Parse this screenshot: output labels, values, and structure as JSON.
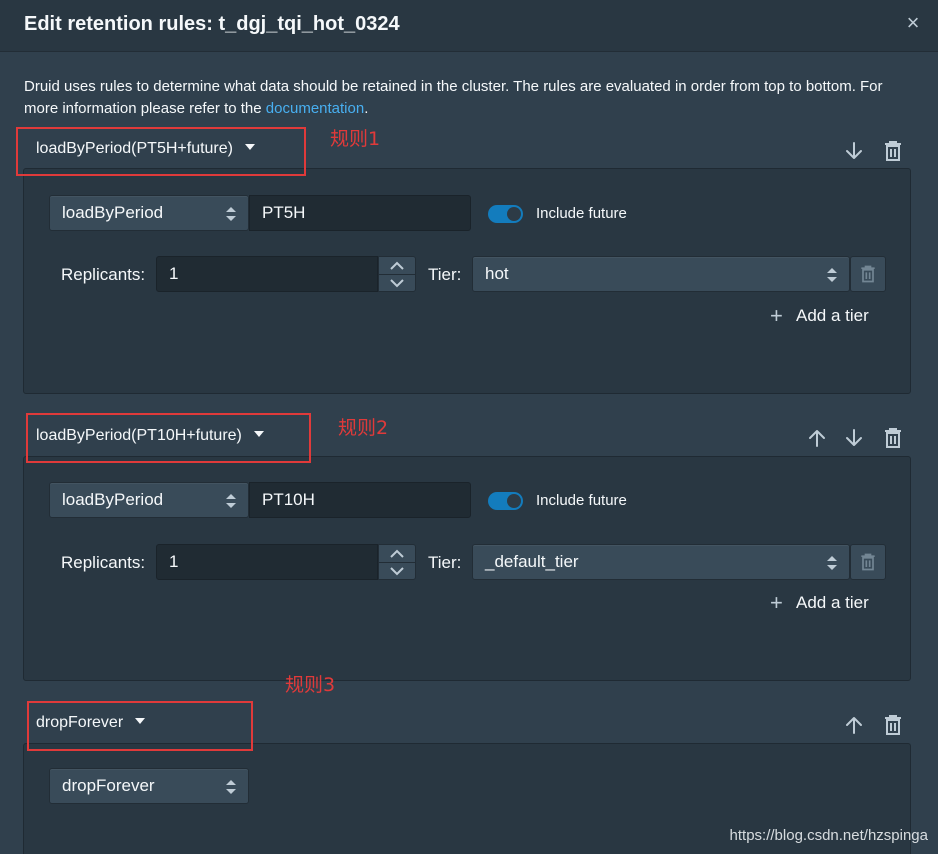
{
  "dialog": {
    "title": "Edit retention rules: t_dgj_tqi_hot_0324",
    "close_icon": "×",
    "description_prefix": "Druid uses rules to determine what data should be retained in the cluster. The rules are evaluated in order from top to bottom. For more information please refer to the ",
    "description_link": "documentation",
    "description_suffix": "."
  },
  "rules": [
    {
      "header_label": "loadByPeriod(PT5H+future)",
      "type": "loadByPeriod",
      "period": "PT5H",
      "include_future_label": "Include future",
      "include_future": true,
      "replicants_label": "Replicants:",
      "replicants": "1",
      "tier_label": "Tier:",
      "tier": "hot",
      "add_tier_label": "Add a tier",
      "annotation": "规则1"
    },
    {
      "header_label": "loadByPeriod(PT10H+future)",
      "type": "loadByPeriod",
      "period": "PT10H",
      "include_future_label": "Include future",
      "include_future": true,
      "replicants_label": "Replicants:",
      "replicants": "1",
      "tier_label": "Tier:",
      "tier": "_default_tier",
      "add_tier_label": "Add a tier",
      "annotation": "规则2"
    },
    {
      "header_label": "dropForever",
      "type": "dropForever",
      "annotation": "规则3"
    }
  ],
  "colors": {
    "background": "#30404d",
    "card": "#293742",
    "accent": "#137cbd",
    "link": "#48aff0",
    "annotation": "#e03a3a"
  },
  "icons": [
    "close-icon",
    "arrow-up-icon",
    "arrow-down-icon",
    "trash-icon",
    "caret-down-icon",
    "plus-icon",
    "double-caret-icon"
  ],
  "watermark": "https://blog.csdn.net/hzspinga"
}
